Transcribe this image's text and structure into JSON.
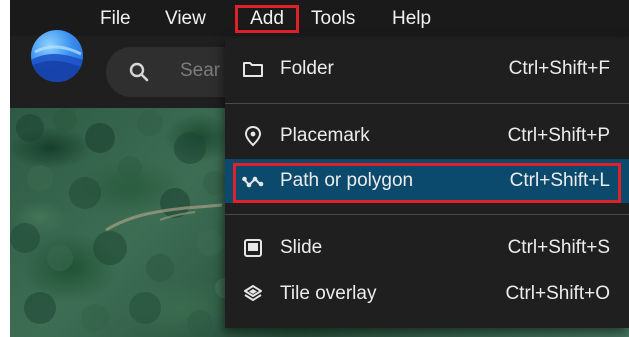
{
  "menubar": {
    "items": [
      {
        "label": "File"
      },
      {
        "label": "View"
      },
      {
        "label": "Add"
      },
      {
        "label": "Tools"
      },
      {
        "label": "Help"
      }
    ],
    "active": "Add"
  },
  "search": {
    "placeholder": "Sear",
    "icon": "search-icon"
  },
  "logo": {
    "icon": "google-earth-logo"
  },
  "add_menu": {
    "items": [
      {
        "label": "Folder",
        "shortcut": "Ctrl+Shift+F",
        "icon": "folder-icon"
      },
      {
        "label": "Placemark",
        "shortcut": "Ctrl+Shift+P",
        "icon": "placemark-pin-icon"
      },
      {
        "label": "Path or polygon",
        "shortcut": "Ctrl+Shift+L",
        "icon": "path-icon",
        "highlighted": true
      },
      {
        "label": "Slide",
        "shortcut": "Ctrl+Shift+S",
        "icon": "slide-icon"
      },
      {
        "label": "Tile overlay",
        "shortcut": "Ctrl+Shift+O",
        "icon": "tile-overlay-icon"
      }
    ]
  },
  "colors": {
    "menu_background": "#1f1f1f",
    "highlight": "#0b4a6c",
    "annotation_red": "#e0202a",
    "text": "#ececec"
  }
}
